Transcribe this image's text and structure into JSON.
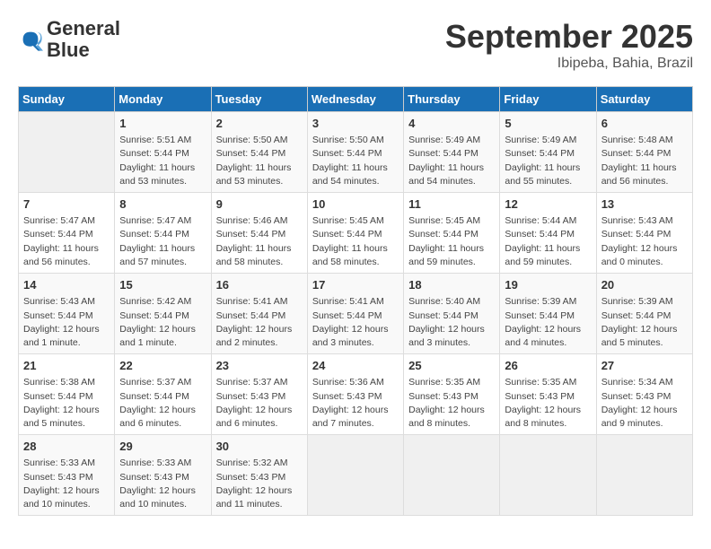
{
  "logo": {
    "line1": "General",
    "line2": "Blue"
  },
  "title": "September 2025",
  "location": "Ibipeba, Bahia, Brazil",
  "weekdays": [
    "Sunday",
    "Monday",
    "Tuesday",
    "Wednesday",
    "Thursday",
    "Friday",
    "Saturday"
  ],
  "weeks": [
    [
      {
        "day": "",
        "info": ""
      },
      {
        "day": "1",
        "info": "Sunrise: 5:51 AM\nSunset: 5:44 PM\nDaylight: 11 hours\nand 53 minutes."
      },
      {
        "day": "2",
        "info": "Sunrise: 5:50 AM\nSunset: 5:44 PM\nDaylight: 11 hours\nand 53 minutes."
      },
      {
        "day": "3",
        "info": "Sunrise: 5:50 AM\nSunset: 5:44 PM\nDaylight: 11 hours\nand 54 minutes."
      },
      {
        "day": "4",
        "info": "Sunrise: 5:49 AM\nSunset: 5:44 PM\nDaylight: 11 hours\nand 54 minutes."
      },
      {
        "day": "5",
        "info": "Sunrise: 5:49 AM\nSunset: 5:44 PM\nDaylight: 11 hours\nand 55 minutes."
      },
      {
        "day": "6",
        "info": "Sunrise: 5:48 AM\nSunset: 5:44 PM\nDaylight: 11 hours\nand 56 minutes."
      }
    ],
    [
      {
        "day": "7",
        "info": "Sunrise: 5:47 AM\nSunset: 5:44 PM\nDaylight: 11 hours\nand 56 minutes."
      },
      {
        "day": "8",
        "info": "Sunrise: 5:47 AM\nSunset: 5:44 PM\nDaylight: 11 hours\nand 57 minutes."
      },
      {
        "day": "9",
        "info": "Sunrise: 5:46 AM\nSunset: 5:44 PM\nDaylight: 11 hours\nand 58 minutes."
      },
      {
        "day": "10",
        "info": "Sunrise: 5:45 AM\nSunset: 5:44 PM\nDaylight: 11 hours\nand 58 minutes."
      },
      {
        "day": "11",
        "info": "Sunrise: 5:45 AM\nSunset: 5:44 PM\nDaylight: 11 hours\nand 59 minutes."
      },
      {
        "day": "12",
        "info": "Sunrise: 5:44 AM\nSunset: 5:44 PM\nDaylight: 11 hours\nand 59 minutes."
      },
      {
        "day": "13",
        "info": "Sunrise: 5:43 AM\nSunset: 5:44 PM\nDaylight: 12 hours\nand 0 minutes."
      }
    ],
    [
      {
        "day": "14",
        "info": "Sunrise: 5:43 AM\nSunset: 5:44 PM\nDaylight: 12 hours\nand 1 minute."
      },
      {
        "day": "15",
        "info": "Sunrise: 5:42 AM\nSunset: 5:44 PM\nDaylight: 12 hours\nand 1 minute."
      },
      {
        "day": "16",
        "info": "Sunrise: 5:41 AM\nSunset: 5:44 PM\nDaylight: 12 hours\nand 2 minutes."
      },
      {
        "day": "17",
        "info": "Sunrise: 5:41 AM\nSunset: 5:44 PM\nDaylight: 12 hours\nand 3 minutes."
      },
      {
        "day": "18",
        "info": "Sunrise: 5:40 AM\nSunset: 5:44 PM\nDaylight: 12 hours\nand 3 minutes."
      },
      {
        "day": "19",
        "info": "Sunrise: 5:39 AM\nSunset: 5:44 PM\nDaylight: 12 hours\nand 4 minutes."
      },
      {
        "day": "20",
        "info": "Sunrise: 5:39 AM\nSunset: 5:44 PM\nDaylight: 12 hours\nand 5 minutes."
      }
    ],
    [
      {
        "day": "21",
        "info": "Sunrise: 5:38 AM\nSunset: 5:44 PM\nDaylight: 12 hours\nand 5 minutes."
      },
      {
        "day": "22",
        "info": "Sunrise: 5:37 AM\nSunset: 5:44 PM\nDaylight: 12 hours\nand 6 minutes."
      },
      {
        "day": "23",
        "info": "Sunrise: 5:37 AM\nSunset: 5:43 PM\nDaylight: 12 hours\nand 6 minutes."
      },
      {
        "day": "24",
        "info": "Sunrise: 5:36 AM\nSunset: 5:43 PM\nDaylight: 12 hours\nand 7 minutes."
      },
      {
        "day": "25",
        "info": "Sunrise: 5:35 AM\nSunset: 5:43 PM\nDaylight: 12 hours\nand 8 minutes."
      },
      {
        "day": "26",
        "info": "Sunrise: 5:35 AM\nSunset: 5:43 PM\nDaylight: 12 hours\nand 8 minutes."
      },
      {
        "day": "27",
        "info": "Sunrise: 5:34 AM\nSunset: 5:43 PM\nDaylight: 12 hours\nand 9 minutes."
      }
    ],
    [
      {
        "day": "28",
        "info": "Sunrise: 5:33 AM\nSunset: 5:43 PM\nDaylight: 12 hours\nand 10 minutes."
      },
      {
        "day": "29",
        "info": "Sunrise: 5:33 AM\nSunset: 5:43 PM\nDaylight: 12 hours\nand 10 minutes."
      },
      {
        "day": "30",
        "info": "Sunrise: 5:32 AM\nSunset: 5:43 PM\nDaylight: 12 hours\nand 11 minutes."
      },
      {
        "day": "",
        "info": ""
      },
      {
        "day": "",
        "info": ""
      },
      {
        "day": "",
        "info": ""
      },
      {
        "day": "",
        "info": ""
      }
    ]
  ]
}
